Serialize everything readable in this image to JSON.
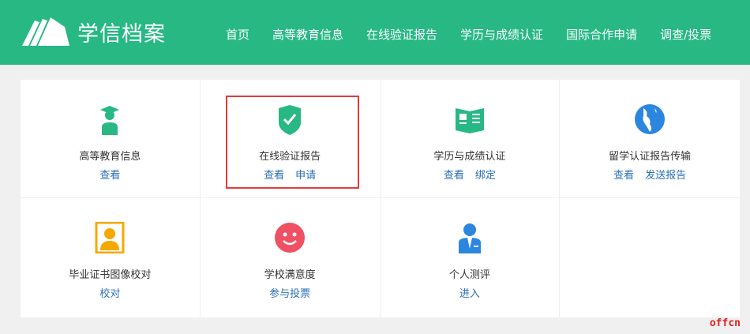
{
  "header": {
    "logo": "学信档案",
    "nav": [
      "首页",
      "高等教育信息",
      "在线验证报告",
      "学历与成绩认证",
      "国际合作申请",
      "调查/投票"
    ]
  },
  "cards": [
    {
      "title": "高等教育信息",
      "links": [
        "查看"
      ],
      "icon": "graduate-icon"
    },
    {
      "title": "在线验证报告",
      "links": [
        "查看",
        "申请"
      ],
      "icon": "shield-check-icon"
    },
    {
      "title": "学历与成绩认证",
      "links": [
        "查看",
        "绑定"
      ],
      "icon": "book-icon"
    },
    {
      "title": "留学认证报告传输",
      "links": [
        "查看",
        "发送报告"
      ],
      "icon": "globe-icon"
    },
    {
      "title": "毕业证书图像校对",
      "links": [
        "校对"
      ],
      "icon": "portrait-icon"
    },
    {
      "title": "学校满意度",
      "links": [
        "参与投票"
      ],
      "icon": "smiley-icon"
    },
    {
      "title": "个人测评",
      "links": [
        "进入"
      ],
      "icon": "person-tie-icon"
    }
  ],
  "colors": {
    "brand": "#27b884",
    "link": "#2a6fb6",
    "highlight": "#e43a3a"
  },
  "watermark": "offcn"
}
